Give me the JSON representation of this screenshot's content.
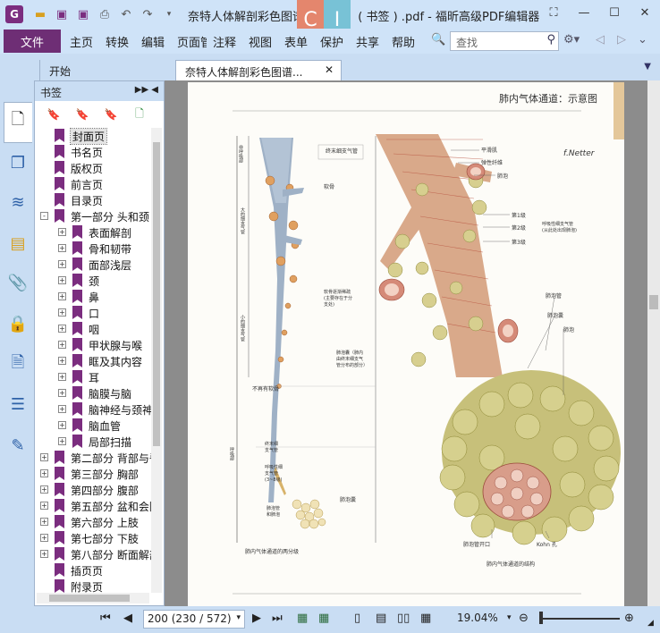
{
  "window": {
    "title": "奈特人体解剖彩色图谱（第3版）( 书签 ) .pdf - 福昕高级PDF编辑器",
    "badge": [
      "C",
      "I"
    ]
  },
  "menu": {
    "file": "文件",
    "items": [
      "主页",
      "转换",
      "编辑",
      "页面管理",
      "注释",
      "视图",
      "表单",
      "保护",
      "共享",
      "帮助"
    ],
    "search_placeholder": "查找"
  },
  "tabs": [
    {
      "label": "开始"
    },
    {
      "label": "奈特人体解剖彩色图谱..."
    }
  ],
  "bookmarks": {
    "title": "书签",
    "items": [
      {
        "label": "封面页",
        "level": 0,
        "expander": "",
        "selected": true
      },
      {
        "label": "书名页",
        "level": 0,
        "expander": ""
      },
      {
        "label": "版权页",
        "level": 0,
        "expander": ""
      },
      {
        "label": "前言页",
        "level": 0,
        "expander": ""
      },
      {
        "label": "目录页",
        "level": 0,
        "expander": ""
      },
      {
        "label": "第一部分 头和颈",
        "level": 0,
        "expander": "-"
      },
      {
        "label": "表面解剖",
        "level": 1,
        "expander": "+"
      },
      {
        "label": "骨和韧带",
        "level": 1,
        "expander": "+"
      },
      {
        "label": "面部浅层",
        "level": 1,
        "expander": "+"
      },
      {
        "label": "颈",
        "level": 1,
        "expander": "+"
      },
      {
        "label": "鼻",
        "level": 1,
        "expander": "+"
      },
      {
        "label": "口",
        "level": 1,
        "expander": "+"
      },
      {
        "label": "咽",
        "level": 1,
        "expander": "+"
      },
      {
        "label": "甲状腺与喉",
        "level": 1,
        "expander": "+"
      },
      {
        "label": "眶及其内容",
        "level": 1,
        "expander": "+"
      },
      {
        "label": "耳",
        "level": 1,
        "expander": "+"
      },
      {
        "label": "脑膜与脑",
        "level": 1,
        "expander": "+"
      },
      {
        "label": "脑神经与颈神经",
        "level": 1,
        "expander": "+"
      },
      {
        "label": "脑血管",
        "level": 1,
        "expander": "+"
      },
      {
        "label": "局部扫描",
        "level": 1,
        "expander": "+"
      },
      {
        "label": "第二部分 背部与脊",
        "level": 0,
        "expander": "+"
      },
      {
        "label": "第三部分 胸部",
        "level": 0,
        "expander": "+"
      },
      {
        "label": "第四部分 腹部",
        "level": 0,
        "expander": "+"
      },
      {
        "label": "第五部分 盆和会阴",
        "level": 0,
        "expander": "+"
      },
      {
        "label": "第六部分 上肢",
        "level": 0,
        "expander": "+"
      },
      {
        "label": "第七部分 下肢",
        "level": 0,
        "expander": "+"
      },
      {
        "label": "第八部分 断面解剖",
        "level": 0,
        "expander": "+"
      },
      {
        "label": "插页页",
        "level": 0,
        "expander": ""
      },
      {
        "label": "附录页",
        "level": 0,
        "expander": ""
      }
    ]
  },
  "page": {
    "heading": "肺内气体通道：示意图",
    "labels_left": {
      "terminal": "终末细支气管",
      "cartilage": "软骨",
      "smooth": "软骨逐渐稀疏\n(主要存在于分\n支处)",
      "no_cart": "不再有软骨",
      "sac": "肺泡囊（肺内\n由终末细支气\n管分布的部分）",
      "term_b": "终末细\n支气管",
      "resp_b": "呼吸性细\n支气管\n(3~8级)",
      "alv_duct": "肺泡管\n和肺泡",
      "alv_sac_label": "肺泡囊",
      "caption_left": "肺内气体通道的两分级"
    },
    "labels_right": {
      "smooth_muscle": "平滑肌",
      "elastic": "弹性纤维",
      "alveolus": "肺泡",
      "gen1": "第1级",
      "gen2": "第2级",
      "gen3": "第3级",
      "resp_bronch": "呼吸性细支气管\n(从此处出现肺泡)",
      "alv_duct": "肺泡管",
      "alv_sac": "肺泡囊",
      "alveoli": "肺泡",
      "duct_opening": "肺泡管开口",
      "kohn": "Kohn 孔",
      "caption_right": "肺内气体通道的结构"
    },
    "side_labels": [
      "非呼吸部",
      "大的细支气管",
      "小的细支气管",
      "呼吸部"
    ]
  },
  "status": {
    "page_field": "200 (230 / 572)",
    "zoom": "19.04%"
  }
}
